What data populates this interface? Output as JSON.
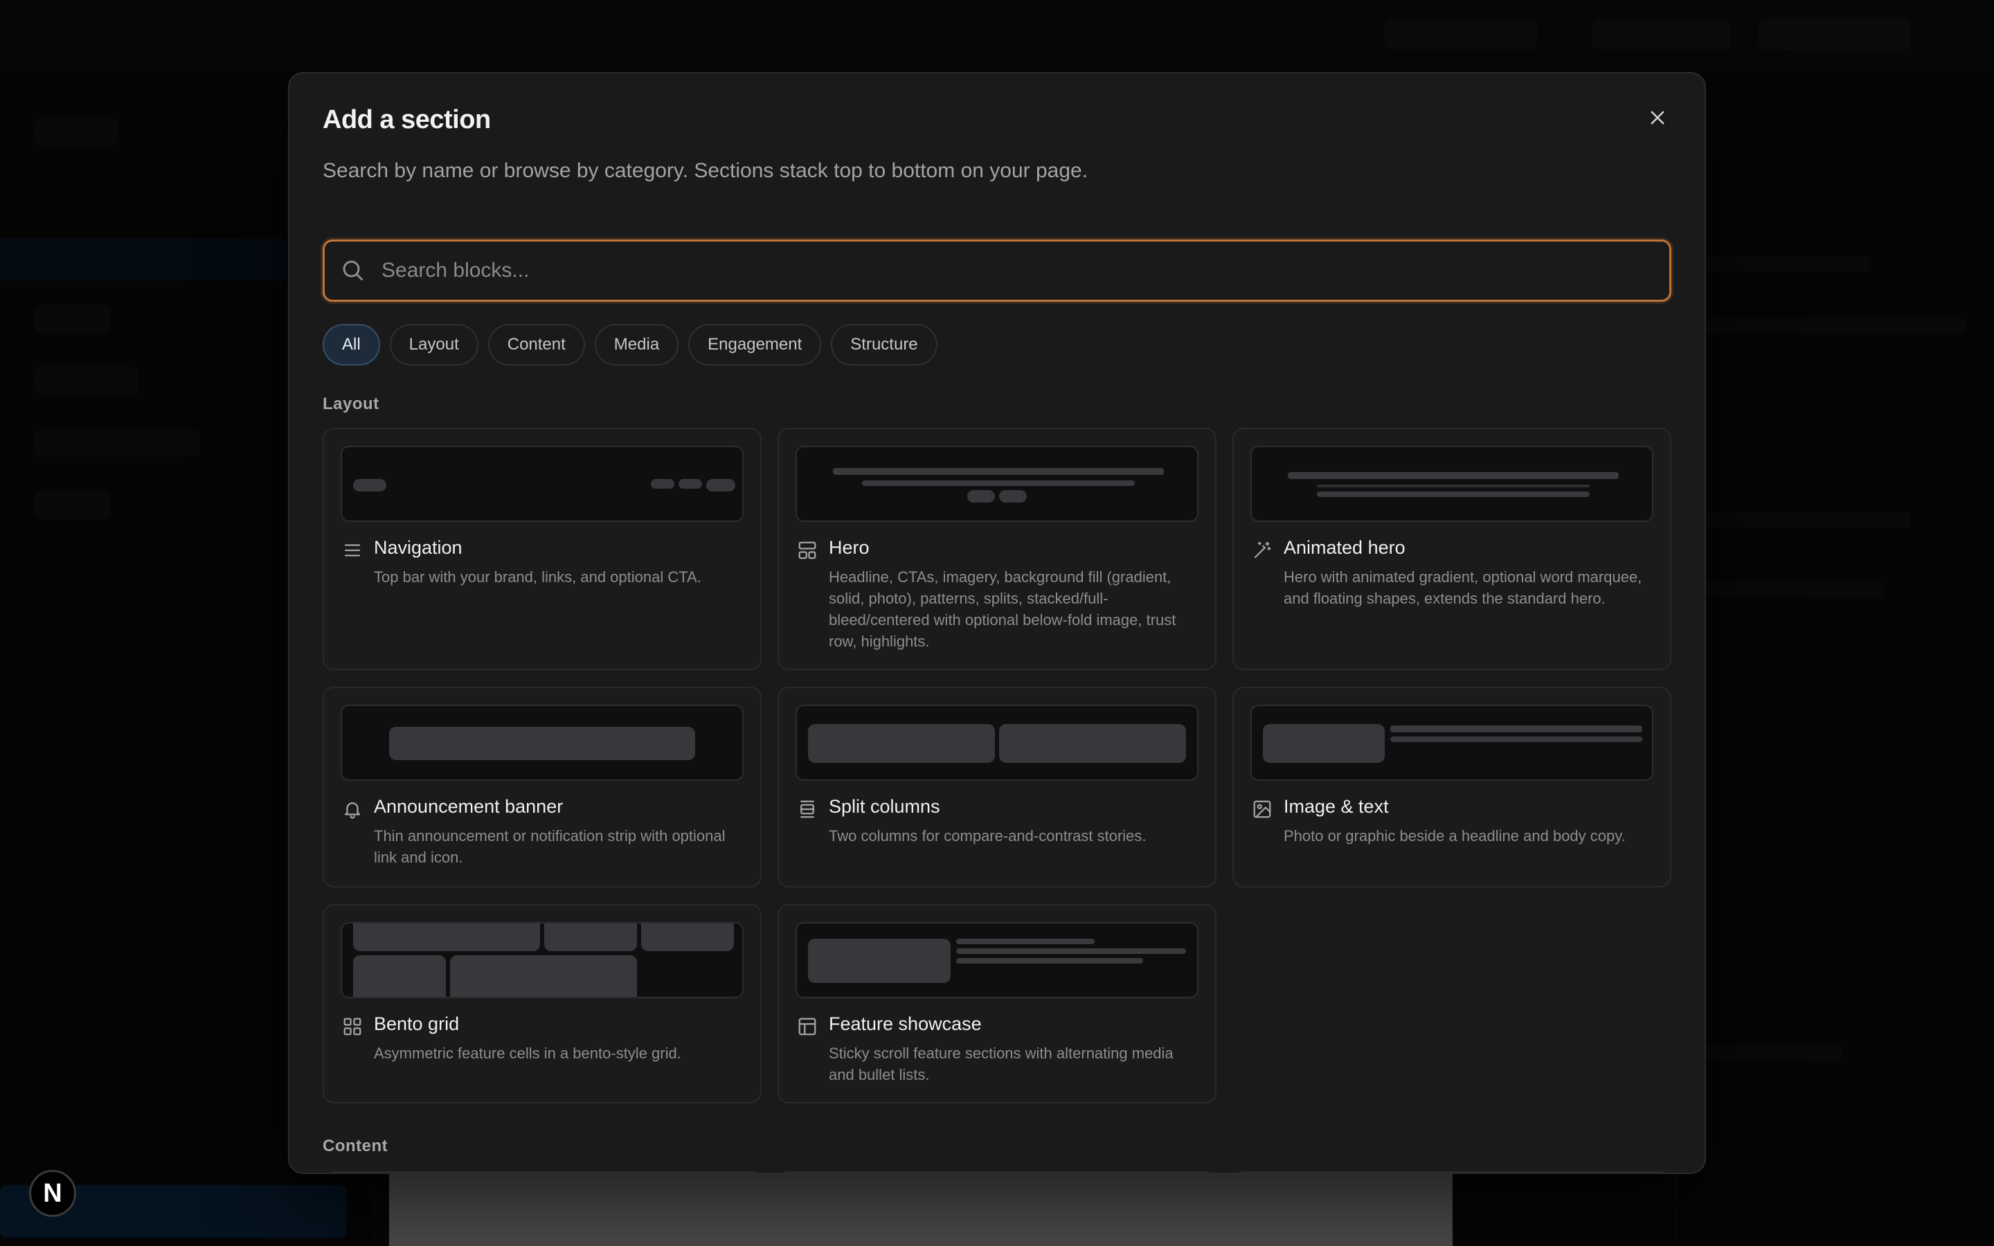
{
  "modal": {
    "title": "Add a section",
    "subtitle": "Search by name or browse by category. Sections stack top to bottom on your page.",
    "close_icon": "close-icon"
  },
  "search": {
    "placeholder": "Search blocks...",
    "value": "",
    "icon": "search-icon"
  },
  "filters": [
    {
      "label": "All",
      "active": true
    },
    {
      "label": "Layout",
      "active": false
    },
    {
      "label": "Content",
      "active": false
    },
    {
      "label": "Media",
      "active": false
    },
    {
      "label": "Engagement",
      "active": false
    },
    {
      "label": "Structure",
      "active": false
    }
  ],
  "sections": [
    {
      "label": "Layout",
      "blocks": [
        {
          "title": "Navigation",
          "icon": "menu-icon",
          "description": "Top bar with your brand, links, and optional CTA."
        },
        {
          "title": "Hero",
          "icon": "layout-icon",
          "description": "Headline, CTAs, imagery, background fill (gradient, solid, photo), patterns, splits, stacked/full-bleed/centered with optional below-fold image, trust row, highlights."
        },
        {
          "title": "Animated hero",
          "icon": "magic-wand-icon",
          "description": "Hero with animated gradient, optional word marquee, and floating shapes, extends the standard hero."
        },
        {
          "title": "Announcement banner",
          "icon": "bell-icon",
          "description": "Thin announcement or notification strip with optional link and icon."
        },
        {
          "title": "Split columns",
          "icon": "split-rows-icon",
          "description": "Two columns for compare-and-contrast stories."
        },
        {
          "title": "Image & text",
          "icon": "image-icon",
          "description": "Photo or graphic beside a headline and body copy."
        },
        {
          "title": "Bento grid",
          "icon": "grid-icon",
          "description": "Asymmetric feature cells in a bento-style grid."
        },
        {
          "title": "Feature showcase",
          "icon": "panel-layout-icon",
          "description": "Sticky scroll feature sections with alternating media and bullet lists."
        }
      ]
    },
    {
      "label": "Content",
      "blocks": []
    }
  ],
  "badge": {
    "letter": "N"
  }
}
